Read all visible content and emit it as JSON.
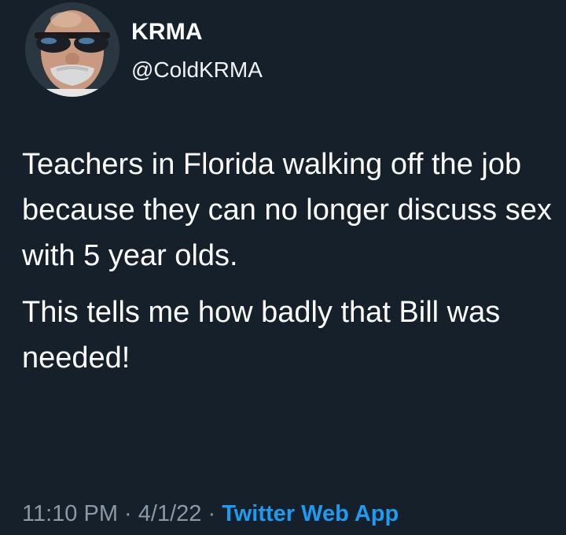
{
  "tweet": {
    "author": {
      "display_name": "KRMA",
      "handle": "@ColdKRMA",
      "avatar_icon": "user-avatar-photo"
    },
    "paragraphs": [
      "Teachers in Florida walking off the job because they can no longer discuss sex with 5 year olds.",
      "This tells me how badly that Bill was needed!"
    ],
    "time": "11:10 PM",
    "separator": " · ",
    "date": "4/1/22",
    "source": "Twitter Web App"
  },
  "colors": {
    "background": "#15202b",
    "text": "#ffffff",
    "muted": "#8b98a5",
    "link": "#1d9bf0"
  }
}
